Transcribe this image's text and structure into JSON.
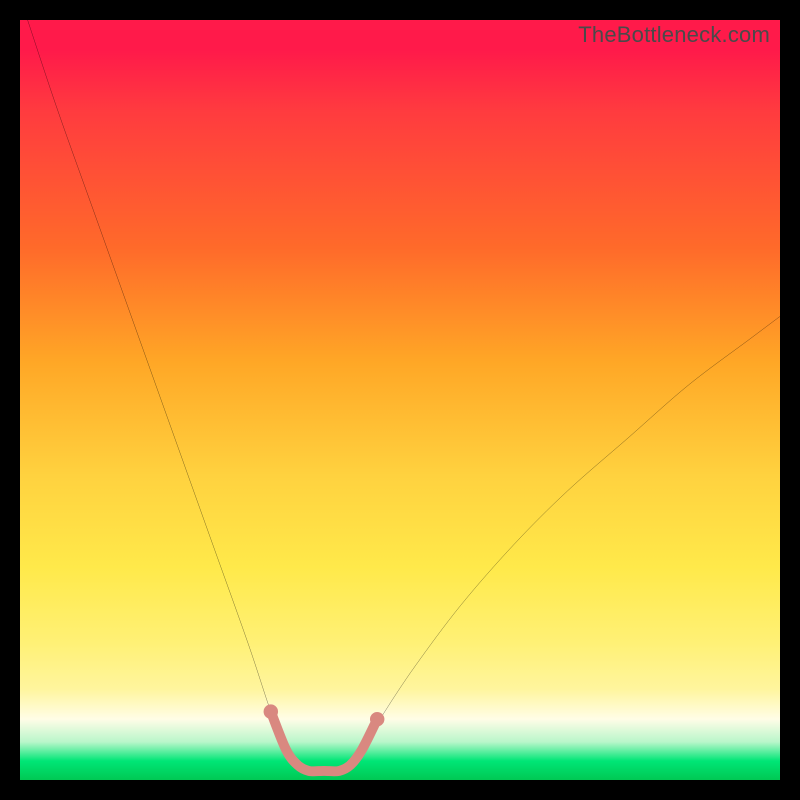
{
  "watermark": "TheBottleneck.com",
  "chart_data": {
    "type": "line",
    "title": "",
    "xlabel": "",
    "ylabel": "",
    "xlim": [
      0,
      100
    ],
    "ylim": [
      0,
      100
    ],
    "series": [
      {
        "name": "bottleneck-curve-left",
        "x": [
          1,
          5,
          10,
          15,
          20,
          25,
          30,
          33,
          35,
          36.5
        ],
        "y": [
          100,
          88,
          74,
          60,
          46,
          32,
          18,
          9,
          4,
          2
        ]
      },
      {
        "name": "bottleneck-curve-right",
        "x": [
          43.5,
          45,
          48,
          52,
          58,
          65,
          72,
          80,
          88,
          96,
          100
        ],
        "y": [
          2,
          4,
          9,
          15,
          23,
          31,
          38,
          45,
          52,
          58,
          61
        ]
      },
      {
        "name": "bottom-highlight",
        "x": [
          33,
          35,
          36.5,
          38,
          40,
          42,
          43.5,
          45,
          47
        ],
        "y": [
          9,
          4,
          2,
          1.2,
          1.2,
          1.2,
          2,
          4,
          8
        ]
      }
    ],
    "highlight_color": "#d98880",
    "curve_color": "#000000"
  }
}
